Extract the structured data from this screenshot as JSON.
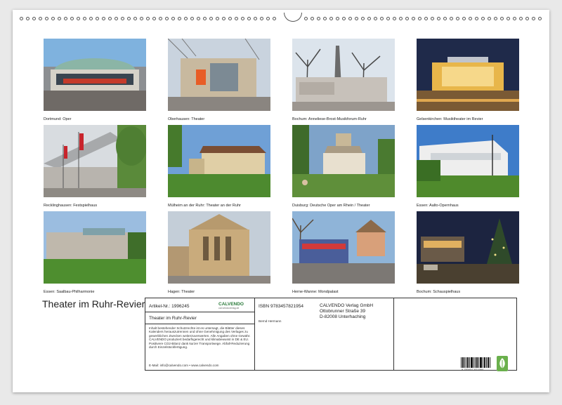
{
  "title": "Theater im Ruhr-Revier",
  "photos": [
    {
      "caption": "Dortmund: Oper"
    },
    {
      "caption": "Oberhausen: Theater"
    },
    {
      "caption": "Bochum: Anneliese-Brost-Musikforum-Ruhr"
    },
    {
      "caption": "Gelsenkirchen: Musiktheater im Revier"
    },
    {
      "caption": "Recklinghausen: Festspielhaus"
    },
    {
      "caption": "Mülheim an der Ruhr: Theater an der Ruhr"
    },
    {
      "caption": "Duisburg: Deutsche Oper am Rhein / Theater"
    },
    {
      "caption": "Essen: Aalto-Opernhaus"
    },
    {
      "caption": "Essen: Saalbau-Philharmonie"
    },
    {
      "caption": "Hagen: Theater"
    },
    {
      "caption": "Herne-Wanne: Mondpalast"
    },
    {
      "caption": "Bochum: Schauspielhaus"
    }
  ],
  "info": {
    "artikel": "Artikel-Nr.: 1996245",
    "calvendo_logo": "CALVENDO",
    "calvendo_logo_sub": "cal.vendoverlag.de",
    "product_title": "Theater im Ruhr-Revier",
    "legal": "Inhalt bestehender Schutzrechte ist es untersagt, die Blätter dieses Kalenders herauszutrennen und ohne Genehmigung des Verlages zu gewerblichen Zwecken weiterzuverwerten. Alle Angaben ohne Gewähr. CALVENDO produziert bedarfsgerecht und klimabewusst in DE & EU. Positivere CO2-Bilanz dank kurzer Transportwege. Abfall-Reduzierung durch Einzelstückfertigung.",
    "email": "E-Mail: info@calvendo.com • www.calvendo.com",
    "isbn": "ISBN 9783457821954",
    "author": "Bernd Hermann",
    "publisher_lines": [
      "CALVENDO Verlag GmbH",
      "Ottobrunner Straße 39",
      "D-82008 Unterhaching"
    ],
    "barcode_number": "9 783457 821954"
  }
}
